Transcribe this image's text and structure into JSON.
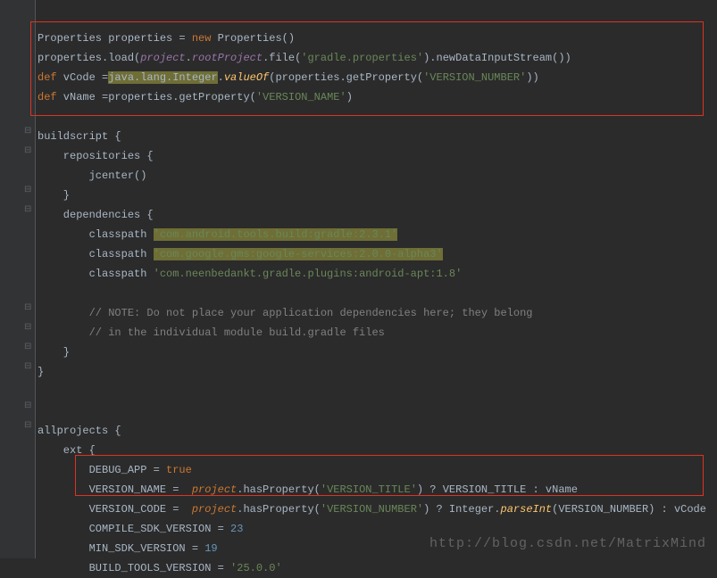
{
  "code": {
    "l1a": "Properties properties = ",
    "l1b": "new",
    "l1c": " Properties()",
    "l2a": "properties.load(",
    "l2b": "project",
    "l2c": ".",
    "l2d": "rootProject",
    "l2e": ".file(",
    "l2f": "'gradle.properties'",
    "l2g": ").newDataInputStream())",
    "l3a": "def",
    "l3b": " vCode =",
    "l3c": "java.lang.Integer",
    "l3d": ".",
    "l3e": "valueOf",
    "l3f": "(properties.getProperty(",
    "l3g": "'VERSION_NUMBER'",
    "l3h": "))",
    "l4a": "def",
    "l4b": " vName =properties.getProperty(",
    "l4c": "'VERSION_NAME'",
    "l4d": ")",
    "l6": "buildscript {",
    "l7": "    repositories {",
    "l8": "        jcenter()",
    "l9": "    }",
    "l10": "    dependencies {",
    "l11a": "        classpath ",
    "l11b": "'com.android.tools.build:gradle:2.3.1'",
    "l12a": "        classpath ",
    "l12b": "'com.google.gms:google-services:2.0.0-alpha3'",
    "l13a": "        classpath ",
    "l13b": "'com.neenbedankt.gradle.plugins:android-apt:1.8'",
    "l15": "        // NOTE: Do not place your application dependencies here; they belong",
    "l16": "        // in the individual module build.gradle files",
    "l17": "    }",
    "l18": "}",
    "l20": "allprojects {",
    "l21": "    ext {",
    "l22a": "        DEBUG_APP = ",
    "l22b": "true",
    "l23a": "        VERSION_NAME =  ",
    "l23b": "project",
    "l23c": ".hasProperty(",
    "l23d": "'VERSION_TITLE'",
    "l23e": ") ? VERSION_TITLE : vName",
    "l24a": "        VERSION_CODE =  ",
    "l24b": "project",
    "l24c": ".hasProperty(",
    "l24d": "'VERSION_NUMBER'",
    "l24e": ") ? Integer.",
    "l24f": "parseInt",
    "l24g": "(VERSION_NUMBER) : vCode",
    "l25a": "        COMPILE_SDK_VERSION = ",
    "l25b": "23",
    "l26a": "        MIN_SDK_VERSION = ",
    "l26b": "19",
    "l27a": "        BUILD_TOOLS_VERSION = ",
    "l27b": "'25.0.0'"
  },
  "watermark": "http://blog.csdn.net/MatrixMind"
}
